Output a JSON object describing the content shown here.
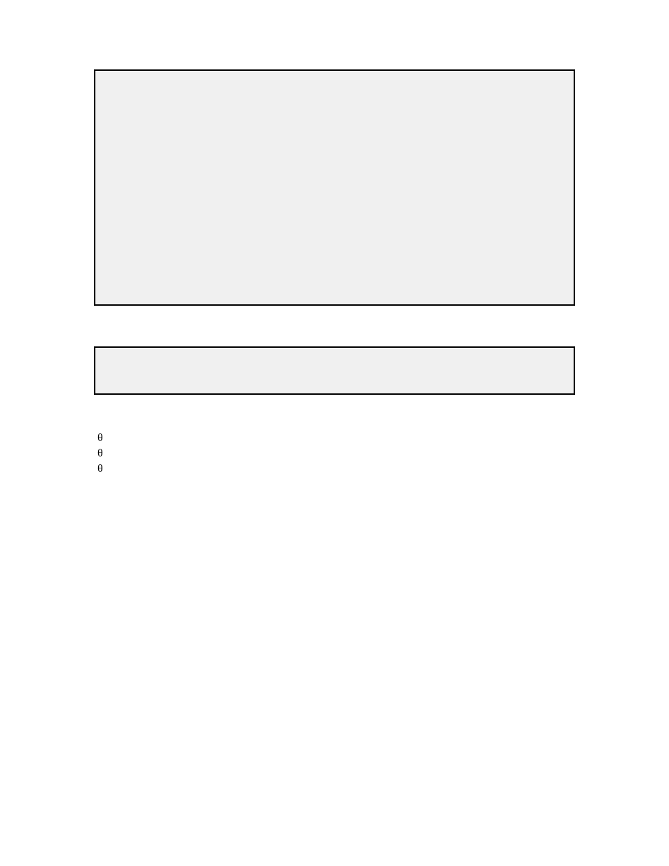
{
  "symbols": {
    "theta1": "θ",
    "theta2": "θ",
    "theta3": "θ"
  }
}
